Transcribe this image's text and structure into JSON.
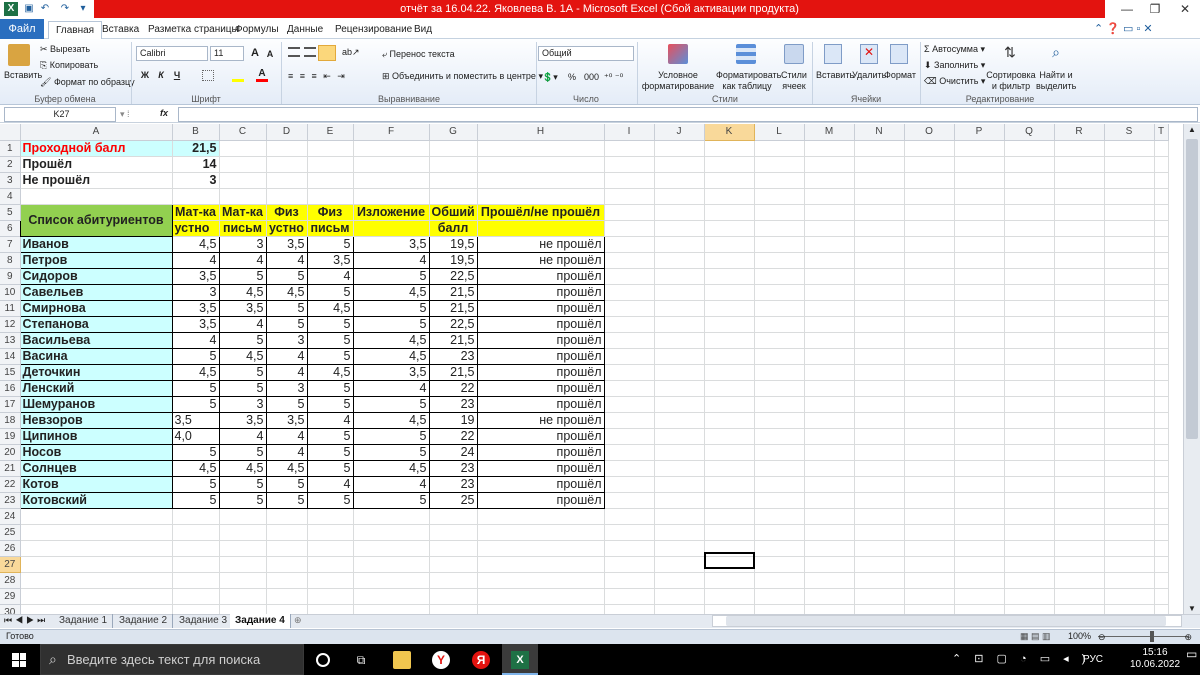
{
  "window": {
    "title": "отчёт за 16.04.22. Яковлева В. 1А  -  Microsoft Excel (Сбой активации продукта)",
    "minimize": "—",
    "restore": "❐",
    "close": "✕"
  },
  "ribbon_tabs": [
    "Файл",
    "Главная",
    "Вставка",
    "Разметка страницы",
    "Формулы",
    "Данные",
    "Рецензирование",
    "Вид"
  ],
  "ribbon": {
    "clipboard": {
      "paste": "Вставить",
      "cut": "Вырезать",
      "copy": "Копировать",
      "format_painter": "Формат по образцу",
      "label": "Буфер обмена"
    },
    "font": {
      "name": "Calibri",
      "size": "11",
      "bold": "Ж",
      "italic": "К",
      "underline": "Ч",
      "grow": "A",
      "shrink": "A",
      "label": "Шрифт"
    },
    "alignment": {
      "wrap": "Перенос текста",
      "merge": "Объединить и поместить в центре",
      "label": "Выравнивание"
    },
    "number": {
      "format": "Общий",
      "percent": "%",
      "thousands": "000",
      "label": "Число"
    },
    "styles": {
      "conditional": "Условное форматирование",
      "as_table": "Форматировать как таблицу",
      "cell_styles": "Стили ячеек",
      "label": "Стили"
    },
    "cells": {
      "insert": "Вставить",
      "delete": "Удалить",
      "format": "Формат",
      "label": "Ячейки"
    },
    "editing": {
      "autosum": "Автосумма",
      "fill": "Заполнить",
      "clear": "Очистить",
      "sort": "Сортировка и фильтр",
      "find": "Найти и выделить",
      "label": "Редактирование"
    }
  },
  "formula_bar": {
    "name_box": "K27",
    "fx": "fx",
    "value": ""
  },
  "columns": [
    "A",
    "B",
    "C",
    "D",
    "E",
    "F",
    "G",
    "H",
    "I",
    "J",
    "K",
    "L",
    "M",
    "N",
    "O",
    "P",
    "Q",
    "R",
    "S",
    "T"
  ],
  "rows": [
    "1",
    "2",
    "3",
    "4",
    "5",
    "6",
    "7",
    "8",
    "9",
    "10",
    "11",
    "12",
    "13",
    "14",
    "15",
    "16",
    "17",
    "18",
    "19",
    "20",
    "21",
    "22",
    "23",
    "24",
    "25",
    "26",
    "27",
    "28",
    "29",
    "30"
  ],
  "summary": [
    {
      "label": "Проходной балл",
      "value": "21,5"
    },
    {
      "label": "Прошёл",
      "value": "14"
    },
    {
      "label": "Не прошёл",
      "value": "3"
    }
  ],
  "table_header": {
    "list_title": "Список абитуриентов",
    "h1": [
      "Мат-ка",
      "Мат-ка",
      "Физ",
      "Физ",
      "Изложение",
      "Обший",
      "Прошёл/не прошёл"
    ],
    "h2": [
      "устно",
      "письм",
      "устно",
      "письм",
      "",
      "балл",
      ""
    ]
  },
  "students": [
    [
      "Иванов",
      "4,5",
      "3",
      "3,5",
      "5",
      "3,5",
      "19,5",
      "не прошёл"
    ],
    [
      "Петров",
      "4",
      "4",
      "4",
      "3,5",
      "4",
      "19,5",
      "не прошёл"
    ],
    [
      "Сидоров",
      "3,5",
      "5",
      "5",
      "4",
      "5",
      "22,5",
      "прошёл"
    ],
    [
      "Савельев",
      "3",
      "4,5",
      "4,5",
      "5",
      "4,5",
      "21,5",
      "прошёл"
    ],
    [
      "Смирнова",
      "3,5",
      "3,5",
      "5",
      "4,5",
      "5",
      "21,5",
      "прошёл"
    ],
    [
      "Степанова",
      "3,5",
      "4",
      "5",
      "5",
      "5",
      "22,5",
      "прошёл"
    ],
    [
      "Васильева",
      "4",
      "5",
      "3",
      "5",
      "4,5",
      "21,5",
      "прошёл"
    ],
    [
      "Васина",
      "5",
      "4,5",
      "4",
      "5",
      "4,5",
      "23",
      "прошёл"
    ],
    [
      "Деточкин",
      "4,5",
      "5",
      "4",
      "4,5",
      "3,5",
      "21,5",
      "прошёл"
    ],
    [
      "Ленский",
      "5",
      "5",
      "3",
      "5",
      "4",
      "22",
      "прошёл"
    ],
    [
      "Шемуранов",
      "5",
      "3",
      "5",
      "5",
      "5",
      "23",
      "прошёл"
    ],
    [
      "Невзоров",
      "3,5",
      "3,5",
      "3,5",
      "4",
      "4,5",
      "19",
      "не прошёл"
    ],
    [
      "Ципинов",
      "4,0",
      "4",
      "4",
      "5",
      "5",
      "22",
      "прошёл"
    ],
    [
      "Носов",
      "5",
      "5",
      "4",
      "5",
      "5",
      "24",
      "прошёл"
    ],
    [
      "Солнцев",
      "4,5",
      "4,5",
      "4,5",
      "5",
      "4,5",
      "23",
      "прошёл"
    ],
    [
      "Котов",
      "5",
      "5",
      "5",
      "4",
      "4",
      "23",
      "прошёл"
    ],
    [
      "Котовский",
      "5",
      "5",
      "5",
      "5",
      "5",
      "25",
      "прошёл"
    ]
  ],
  "left_aligned_b": [
    11,
    12
  ],
  "sheets": [
    "Задание 1",
    "Задание 2",
    "Задание 3",
    "Задание 4"
  ],
  "active_sheet": "Задание 4",
  "status": {
    "ready": "Готово",
    "zoom": "100%"
  },
  "taskbar": {
    "search_placeholder": "Введите здесь текст для поиска",
    "lang": "РУС",
    "time": "15:16",
    "date": "10.06.2022"
  },
  "colors": {
    "title_red": "#e3130f",
    "header_yellow": "#ffff00",
    "names_cyan": "#ccffff",
    "list_green": "#92d050",
    "label_red": "#ff0000"
  }
}
